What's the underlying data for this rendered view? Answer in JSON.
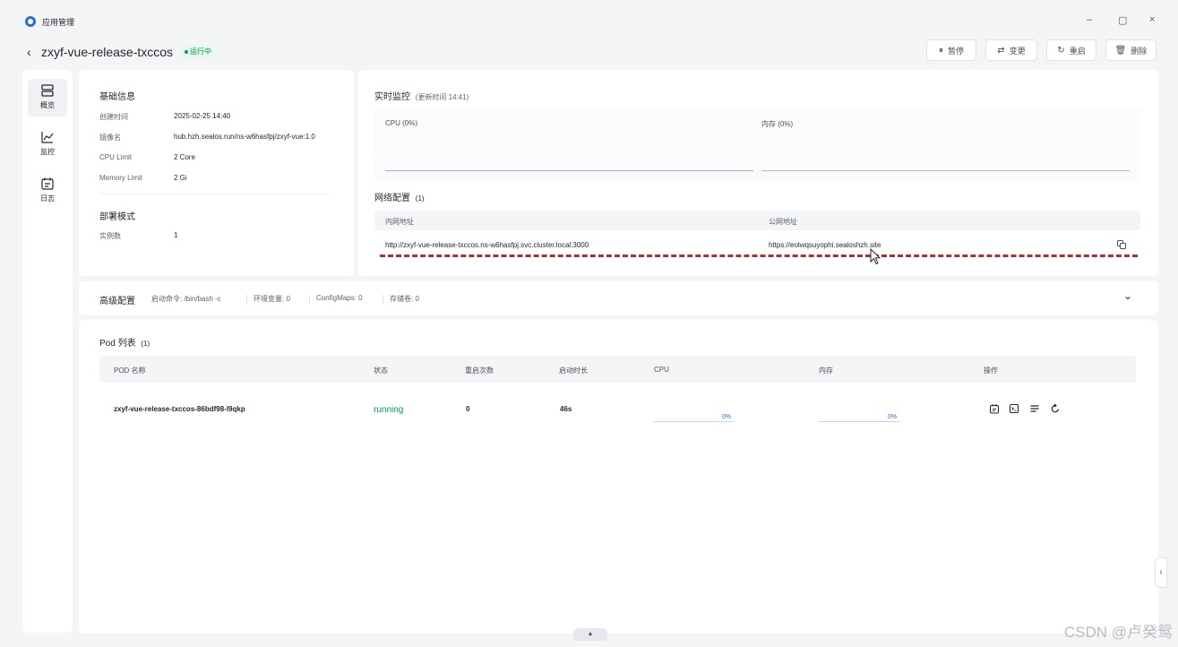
{
  "window": {
    "title": "应用管理",
    "controls": {
      "minimize": "–",
      "restore": "▢",
      "close": "×"
    }
  },
  "header": {
    "back_icon": "‹",
    "app_name": "zxyf-vue-release-txccos",
    "status": "运行中",
    "buttons": {
      "pause": "暂停",
      "change": "变更",
      "restart": "重启",
      "delete": "删除"
    },
    "button_icons": {
      "pause": "⏸",
      "change": "⇄",
      "restart": "↻",
      "delete": "🗑"
    }
  },
  "nav": {
    "items": [
      {
        "label": "概览",
        "icon": "server-icon"
      },
      {
        "label": "监控",
        "icon": "chart-icon"
      },
      {
        "label": "日志",
        "icon": "log-icon"
      }
    ]
  },
  "basic": {
    "title": "基础信息",
    "rows": [
      {
        "label": "创建时间",
        "value": "2025-02-25 14:40"
      },
      {
        "label": "镜像名",
        "value": "hub.hzh.sealos.run/ns-w6hasfpj/zxyf-vue:1.0"
      },
      {
        "label": "CPU Limit",
        "value": "2 Core"
      },
      {
        "label": "Memory Limit",
        "value": "2 Gi"
      }
    ],
    "deploy_title": "部署模式",
    "deploy_rows": [
      {
        "label": "实例数",
        "value": "1"
      }
    ]
  },
  "monitor": {
    "title": "实时监控",
    "subtitle": "(更新时间 14:41)",
    "cpu_label": "CPU (0%)",
    "mem_label": "内存 (0%)",
    "cpu_color": "#8fb4ea",
    "mem_color": "#b9b4ec"
  },
  "network": {
    "title": "网络配置",
    "count": "(1)",
    "internal_header": "内网地址",
    "public_header": "公网地址",
    "internal_value": "http://zxyf-vue-release-txccos.ns-w6hasfpj.svc.cluster.local:3000",
    "public_value": "https://eolwqsuyophi.sealoshzh.site",
    "copy_icon": "copy-icon"
  },
  "advanced": {
    "title": "高级配置",
    "items": [
      "启动命令: /bin/bash -c",
      "环境变量: 0",
      "ConfigMaps: 0",
      "存储卷: 0"
    ],
    "toggle": "⌄"
  },
  "pods": {
    "title": "Pod 列表",
    "count": "(1)",
    "columns": [
      "POD 名称",
      "状态",
      "重启次数",
      "启动时长",
      "CPU",
      "内存",
      "操作"
    ],
    "rows": [
      {
        "name": "zxyf-vue-release-txccos-86bdf98-l9qkp",
        "status": "running",
        "restarts": "0",
        "uptime": "46s",
        "cpu": "0%",
        "memory": "0%"
      }
    ],
    "status_color": "#039855"
  },
  "watermark": "CSDN @卢癸鸳",
  "side_tab": "‹",
  "bottom_handle": "▲"
}
